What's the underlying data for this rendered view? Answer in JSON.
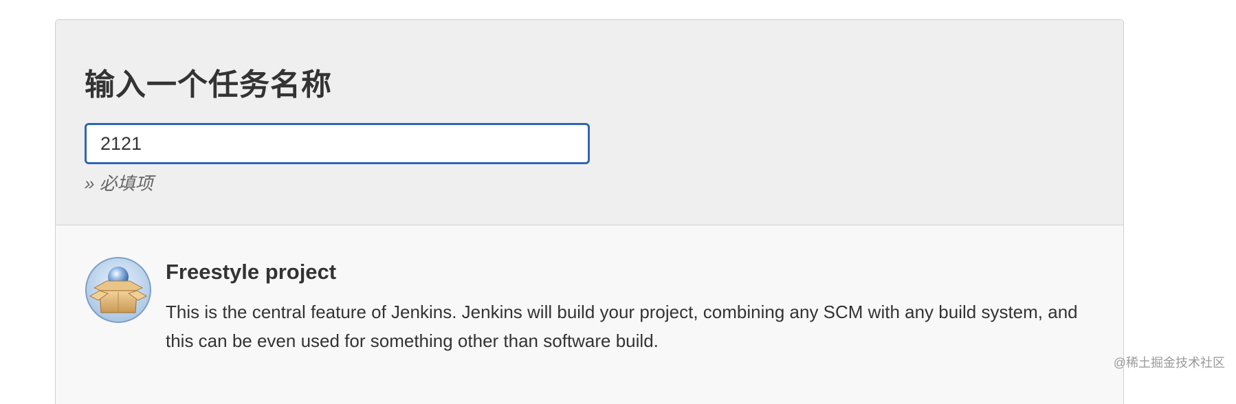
{
  "form": {
    "title": "输入一个任务名称",
    "name_value": "2121",
    "required_note": "» 必填项"
  },
  "items": [
    {
      "icon": "freestyle-project-icon",
      "title": "Freestyle project",
      "description": "This is the central feature of Jenkins. Jenkins will build your project, combining any SCM with any build system, and this can be even used for something other than software build."
    }
  ],
  "watermark": "@稀土掘金技术社区",
  "colors": {
    "accent": "#2f64b8",
    "header_bg": "#efefef",
    "panel_bg": "#f8f8f8"
  }
}
